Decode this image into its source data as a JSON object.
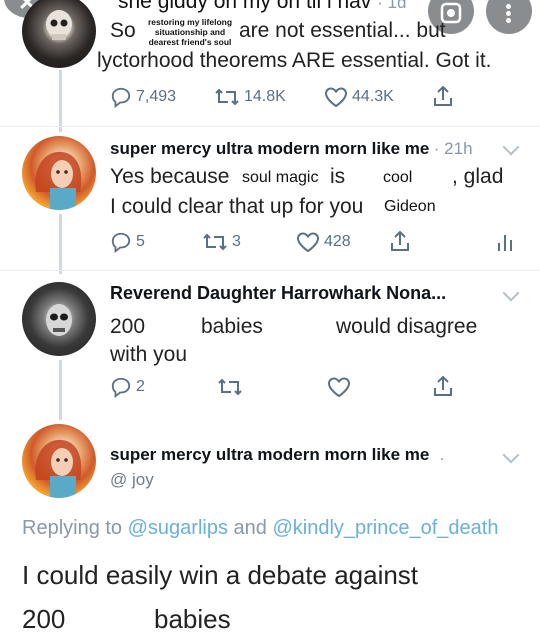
{
  "tweet1": {
    "header_text": "she giddy on my on til l nav",
    "header_time": "· 1d",
    "word_so": "So",
    "overlay_note": [
      "restoring my lifelong",
      "situationship and",
      "dearest friend's soul"
    ],
    "line1_rest": "are not essential... but",
    "line2": "lyctorhood theorems ARE essential. Got it.",
    "stats": {
      "replies": "7,493",
      "retweets": "14.8K",
      "likes": "44.3K"
    }
  },
  "tweet2": {
    "name": "super mercy ultra modern morn like me",
    "time": "· 21h",
    "line1_a": "Yes because",
    "overlay_mid": "soul magic",
    "line1_b": "is",
    "overlay_cool": "cool",
    "line1_c": ", glad",
    "line2": "I could clear that up for you",
    "overlay_end": "Gideon",
    "stats": {
      "replies": "5",
      "retweets": "3",
      "likes": "428"
    }
  },
  "tweet3": {
    "name": "Reverend Daughter Harrowhark Nona...",
    "num": "200",
    "word_babies": "babies",
    "line1_end": "would disagree",
    "line2": "with you",
    "stats": {
      "replies": "2"
    }
  },
  "tweet4": {
    "name": "super mercy ultra modern morn like me",
    "dot": ".",
    "handle": "@ joy",
    "replying_prefix": "Replying to",
    "reply_user1": "@sugarlips",
    "reply_and": "and",
    "reply_user2": "@kindly_prince_of_death",
    "body_line1": "I could easily win a debate against",
    "body_num": "200",
    "body_word": "babies"
  }
}
